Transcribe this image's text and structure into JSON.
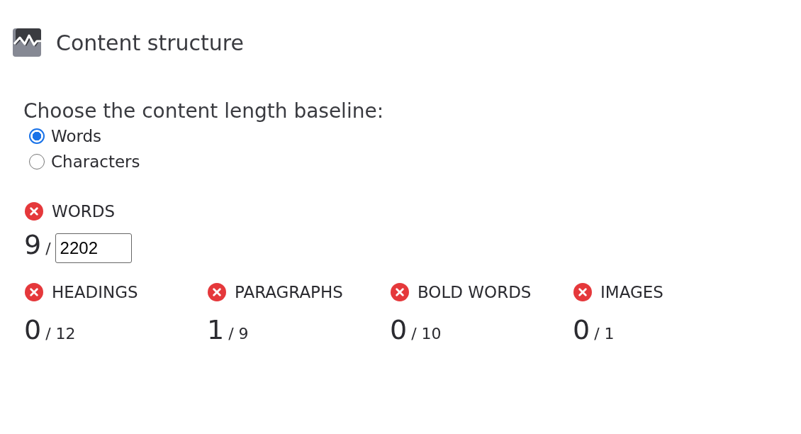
{
  "header": {
    "title": "Content structure"
  },
  "baseline": {
    "prompt": "Choose the content length baseline:",
    "options": [
      {
        "label": "Words",
        "selected": true
      },
      {
        "label": "Characters",
        "selected": false
      }
    ]
  },
  "words": {
    "label": "WORDS",
    "passed": false,
    "count": "9",
    "separator": "/",
    "target": "2202"
  },
  "metrics": [
    {
      "label": "HEADINGS",
      "passed": false,
      "count": "0",
      "total": "/ 12"
    },
    {
      "label": "PARAGRAPHS",
      "passed": false,
      "count": "1",
      "total": "/ 9"
    },
    {
      "label": "BOLD WORDS",
      "passed": false,
      "count": "0",
      "total": "/ 10"
    },
    {
      "label": "IMAGES",
      "passed": false,
      "count": "0",
      "total": "/ 1"
    }
  ]
}
